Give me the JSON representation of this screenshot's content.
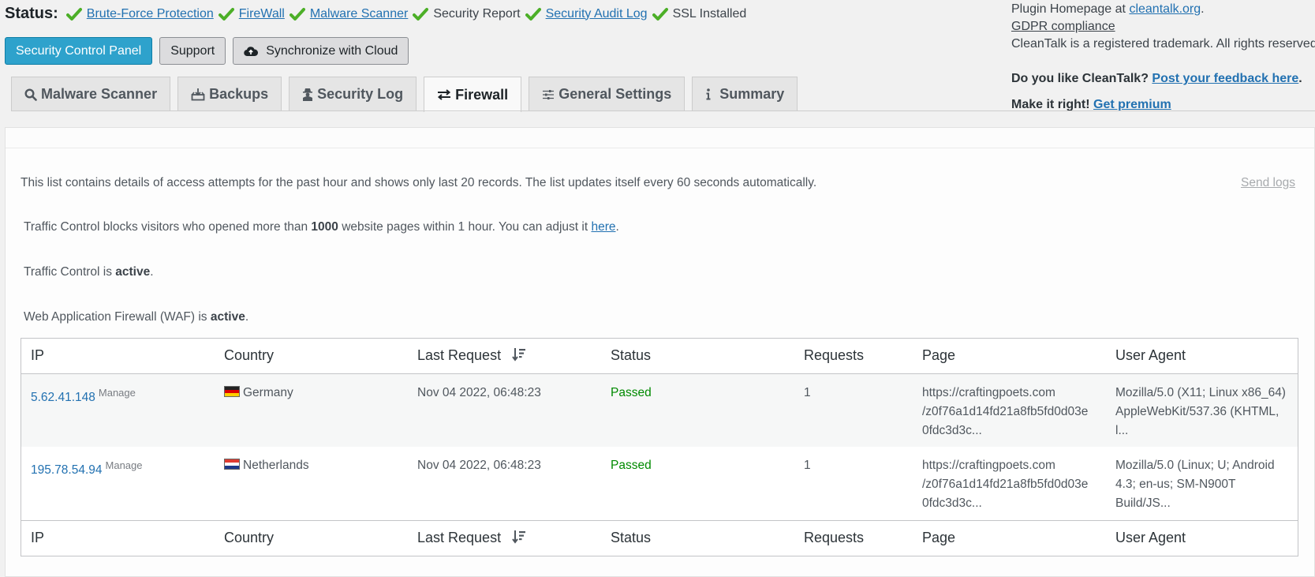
{
  "status": {
    "title": "Status:",
    "items": [
      {
        "label": "Brute-Force Protection",
        "link": true
      },
      {
        "label": "FireWall",
        "link": true
      },
      {
        "label": "Malware Scanner",
        "link": true
      },
      {
        "label": "Security Report",
        "link": false
      },
      {
        "label": "Security Audit Log",
        "link": true
      },
      {
        "label": "SSL Installed",
        "link": false
      }
    ]
  },
  "right_info": {
    "homepage_prefix": "Plugin Homepage at ",
    "homepage_link": "cleantalk.org",
    "homepage_suffix": ".",
    "gdpr": "GDPR compliance",
    "trademark": "CleanTalk is a registered trademark. All rights reserved.",
    "feedback_prefix": "Do you like CleanTalk? ",
    "feedback_link": "Post your feedback here",
    "feedback_suffix": ".",
    "premium_prefix": "Make it right! ",
    "premium_link": "Get premium"
  },
  "buttons": {
    "control_panel": "Security Control Panel",
    "support": "Support",
    "sync": "Synchronize with Cloud"
  },
  "tabs": [
    {
      "label": "Malware Scanner",
      "icon": "search-icon",
      "active": false
    },
    {
      "label": "Backups",
      "icon": "download-tray-icon",
      "active": false
    },
    {
      "label": "Security Log",
      "icon": "spy-icon",
      "active": false
    },
    {
      "label": "Firewall",
      "icon": "exchange-arrows-icon",
      "active": true
    },
    {
      "label": "General Settings",
      "icon": "sliders-icon",
      "active": false
    },
    {
      "label": "Summary",
      "icon": "info-icon",
      "active": false
    }
  ],
  "firewall": {
    "description": "This list contains details of access attempts for the past hour and shows only last 20 records. The list updates itself every 60 seconds automatically.",
    "send_logs": "Send logs",
    "traffic_prefix": "Traffic Control blocks visitors who opened more than ",
    "traffic_limit": "1000",
    "traffic_middle": " website pages within 1 hour. You can adjust it ",
    "traffic_link": "here",
    "traffic_suffix": ".",
    "tc_status_prefix": "Traffic Control is ",
    "tc_status": "active",
    "waf_prefix": "Web Application Firewall (WAF) is ",
    "waf_status": "active",
    "period": "."
  },
  "table": {
    "columns": [
      "IP",
      "Country",
      "Last Request",
      "Status",
      "Requests",
      "Page",
      "User Agent"
    ],
    "manage_label": "Manage",
    "rows": [
      {
        "ip": "5.62.41.148",
        "country": "Germany",
        "flag": "de",
        "last_request": "Nov 04 2022, 06:48:23",
        "status": "Passed",
        "requests": "1",
        "page_lines": [
          "https://craftingpoets.com",
          "/z0f76a1d14fd21a8fb5fd0d03e",
          "0fdc3d3c..."
        ],
        "agent_lines": [
          "Mozilla/5.0 (X11; Linux x86_64)",
          "AppleWebKit/537.36 (KHTML,",
          "l..."
        ]
      },
      {
        "ip": "195.78.54.94",
        "country": "Netherlands",
        "flag": "nl",
        "last_request": "Nov 04 2022, 06:48:23",
        "status": "Passed",
        "requests": "1",
        "page_lines": [
          "https://craftingpoets.com",
          "/z0f76a1d14fd21a8fb5fd0d03e",
          "0fdc3d3c..."
        ],
        "agent_lines": [
          "Mozilla/5.0 (Linux; U; Android",
          "4.3; en-us; SM-N900T",
          "Build/JS..."
        ]
      }
    ]
  },
  "colors": {
    "primary_button": "#2ea2cc",
    "link": "#2271b1",
    "passed": "#008a00",
    "check": "#4caf27"
  }
}
